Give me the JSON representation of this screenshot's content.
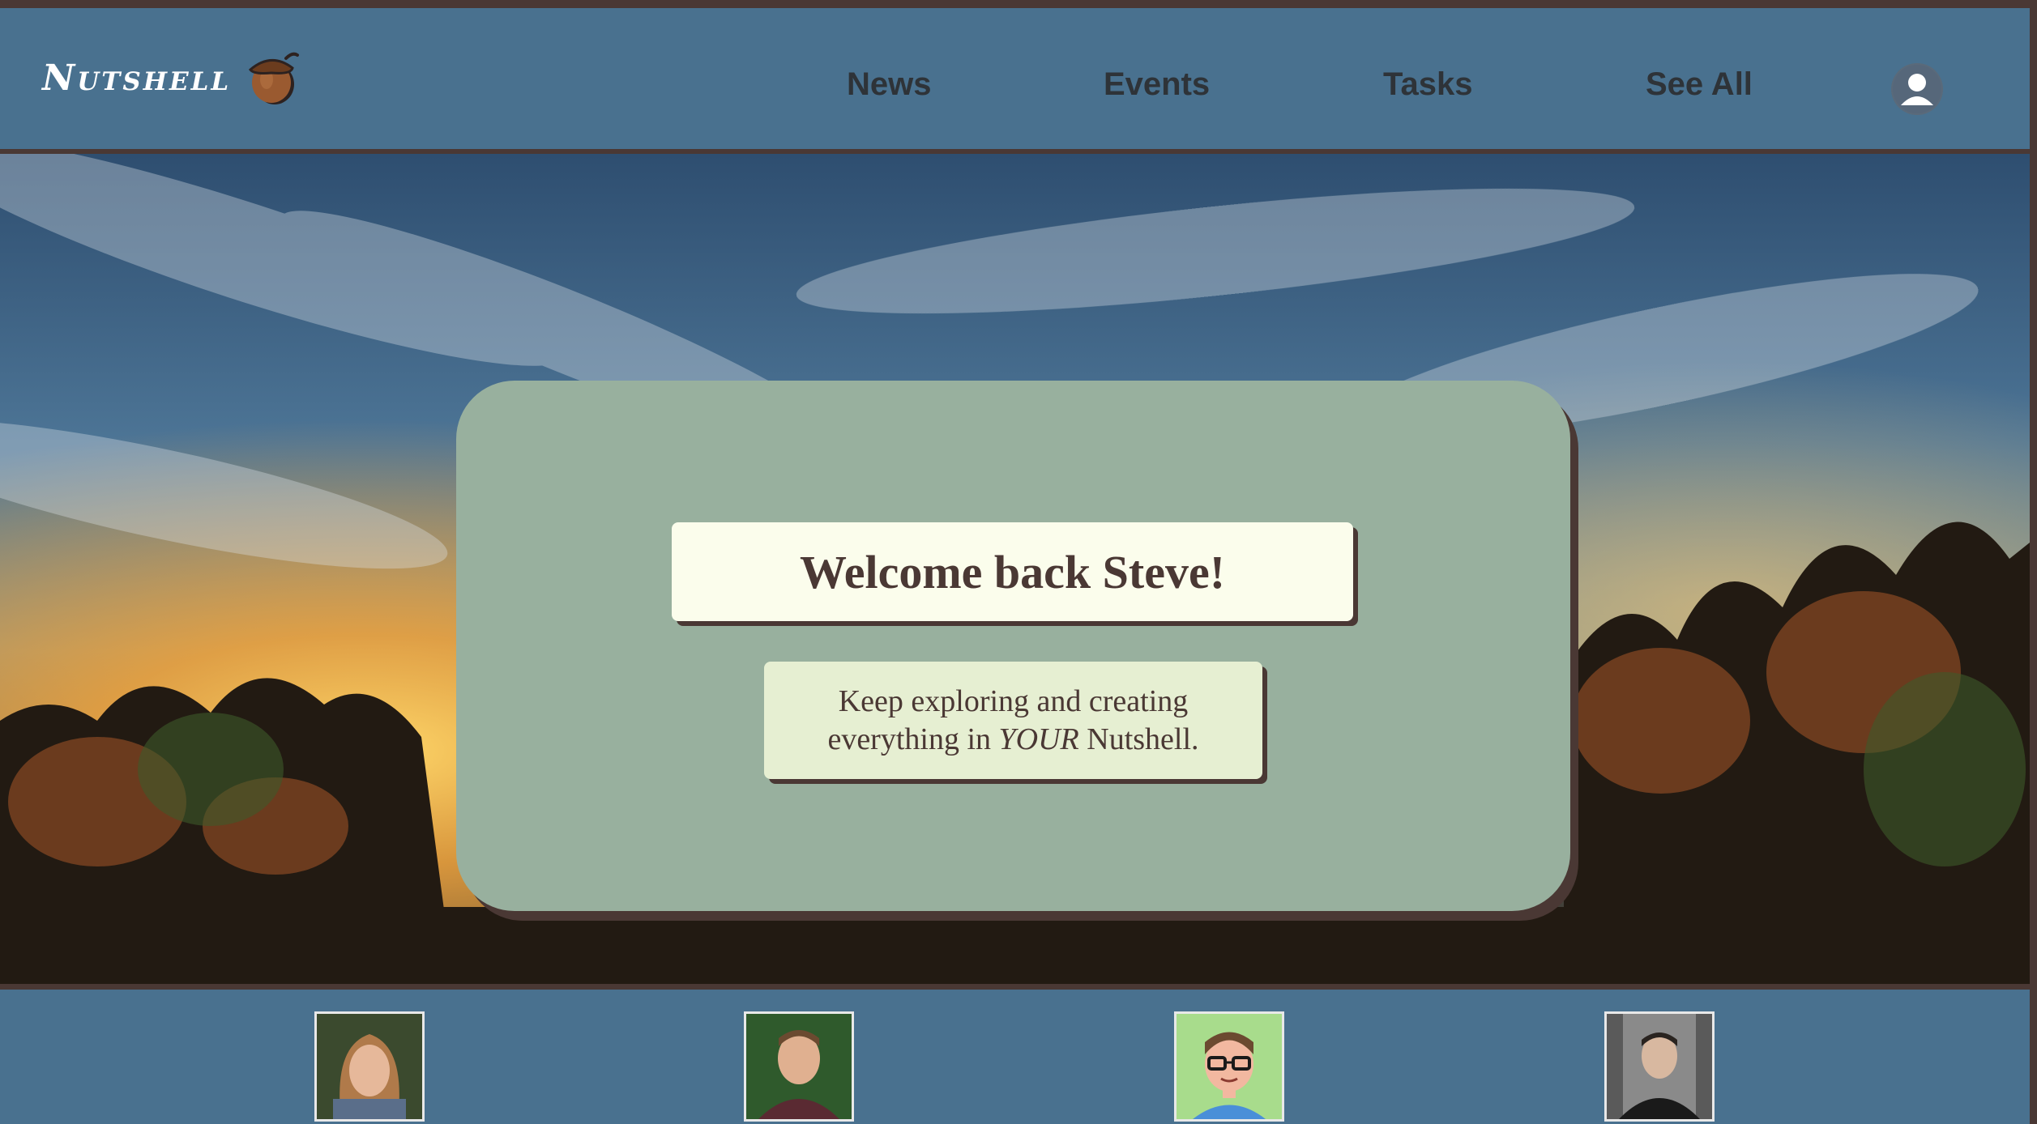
{
  "header": {
    "logo_text": "Nutshell",
    "nav": [
      {
        "label": "News"
      },
      {
        "label": "Events"
      },
      {
        "label": "Tasks"
      },
      {
        "label": "See All"
      }
    ]
  },
  "welcome": {
    "title": "Welcome back Steve!",
    "line1": "Keep exploring and creating",
    "line2_prefix": "everything in ",
    "line2_emphasis": "YOUR",
    "line2_suffix": " Nutshell."
  },
  "icons": {
    "logo": "acorn-icon",
    "profile": "user-avatar-icon"
  },
  "colors": {
    "header_bg": "#49718f",
    "card_bg": "#98b09e",
    "accent_brown": "#4a3834",
    "welcome_bg": "#fbfdec",
    "sub_bg": "#e6efd2"
  }
}
